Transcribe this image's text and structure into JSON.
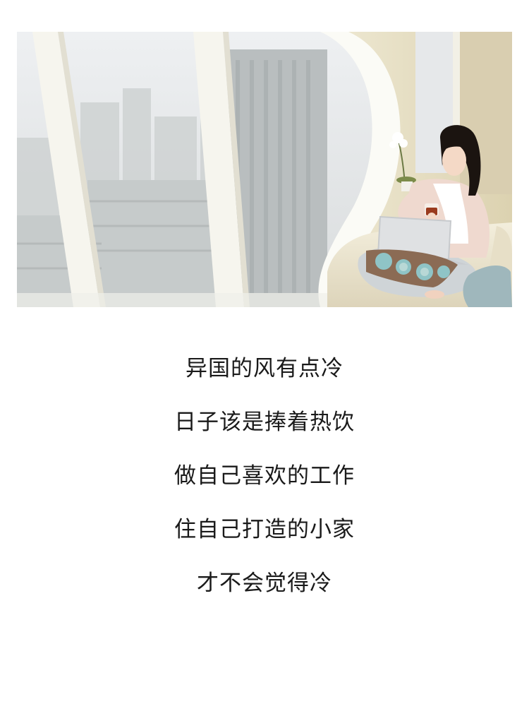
{
  "photo": {
    "subject": "woman-with-laptop-and-tea-by-window",
    "colors": {
      "sky": "#e4e6e8",
      "window_frame": "#f4f3ea",
      "wall": "#e8e0c6",
      "sofa": "#eee8d5",
      "cardigan": "#efd9cf",
      "hair": "#1b1410",
      "pillow_teal": "#8fc4c6",
      "pillow_brown": "#8b6b54"
    }
  },
  "poem": {
    "lines": [
      "异国的风有点冷",
      "日子该是捧着热饮",
      "做自己喜欢的工作",
      "住自己打造的小家",
      "才不会觉得冷"
    ]
  }
}
